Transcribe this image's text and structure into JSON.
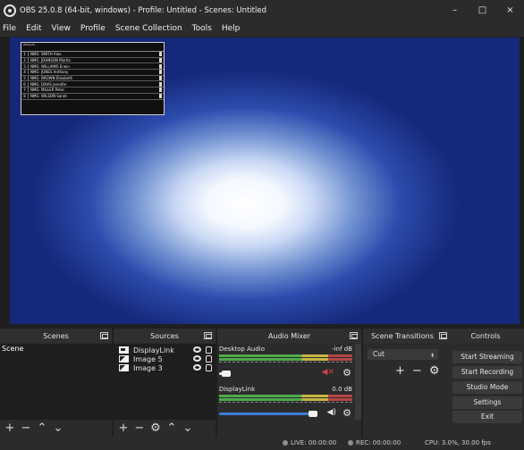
{
  "window": {
    "title": "OBS 25.0.8 (64-bit, windows) - Profile: Untitled - Scenes: Untitled",
    "minimize": "–",
    "maximize": "□",
    "close": "×"
  },
  "menu": [
    "File",
    "Edit",
    "View",
    "Profile",
    "Scene Collection",
    "Tools",
    "Help"
  ],
  "overlay": {
    "header": "RESULTS",
    "rows": [
      {
        "num": "1",
        "club": "NMG",
        "name": "SMITH Alex"
      },
      {
        "num": "2",
        "club": "NMG",
        "name": "JOHNSON Martin"
      },
      {
        "num": "3",
        "club": "NMG",
        "name": "WILLIAMS Erwin"
      },
      {
        "num": "4",
        "club": "NMG",
        "name": "JONES Anthony"
      },
      {
        "num": "5",
        "club": "NMG",
        "name": "BROWN Elizabeth"
      },
      {
        "num": "6",
        "club": "NMG",
        "name": "DAVIS Jennifer"
      },
      {
        "num": "7",
        "club": "NMG",
        "name": "MILLER Peter"
      },
      {
        "num": "8",
        "club": "NMG",
        "name": "WILSON Sarah"
      }
    ]
  },
  "docks": {
    "scenes": {
      "title": "Scenes",
      "items": [
        "Scene"
      ]
    },
    "sources": {
      "title": "Sources",
      "items": [
        {
          "label": "DisplayLink",
          "icon": "display-capture-icon"
        },
        {
          "label": "Image 5",
          "icon": "image-icon"
        },
        {
          "label": "Image 3",
          "icon": "image-icon"
        }
      ]
    },
    "mixer": {
      "title": "Audio Mixer",
      "tracks": [
        {
          "name": "Desktop Audio",
          "db": "-inf dB",
          "volume_fraction": 0.08,
          "muted": true
        },
        {
          "name": "DisplayLink",
          "db": "0.0 dB",
          "volume_fraction": 1.0,
          "muted": false
        }
      ]
    },
    "transitions": {
      "title": "Scene Transitions",
      "selected": "Cut"
    },
    "controls": {
      "title": "Controls",
      "buttons": [
        "Start Streaming",
        "Start Recording",
        "Studio Mode",
        "Settings",
        "Exit"
      ]
    }
  },
  "status": {
    "live": "LIVE: 00:00:00",
    "rec": "REC: 00:00:00",
    "cpu": "CPU: 3.0%, 30.00 fps"
  }
}
